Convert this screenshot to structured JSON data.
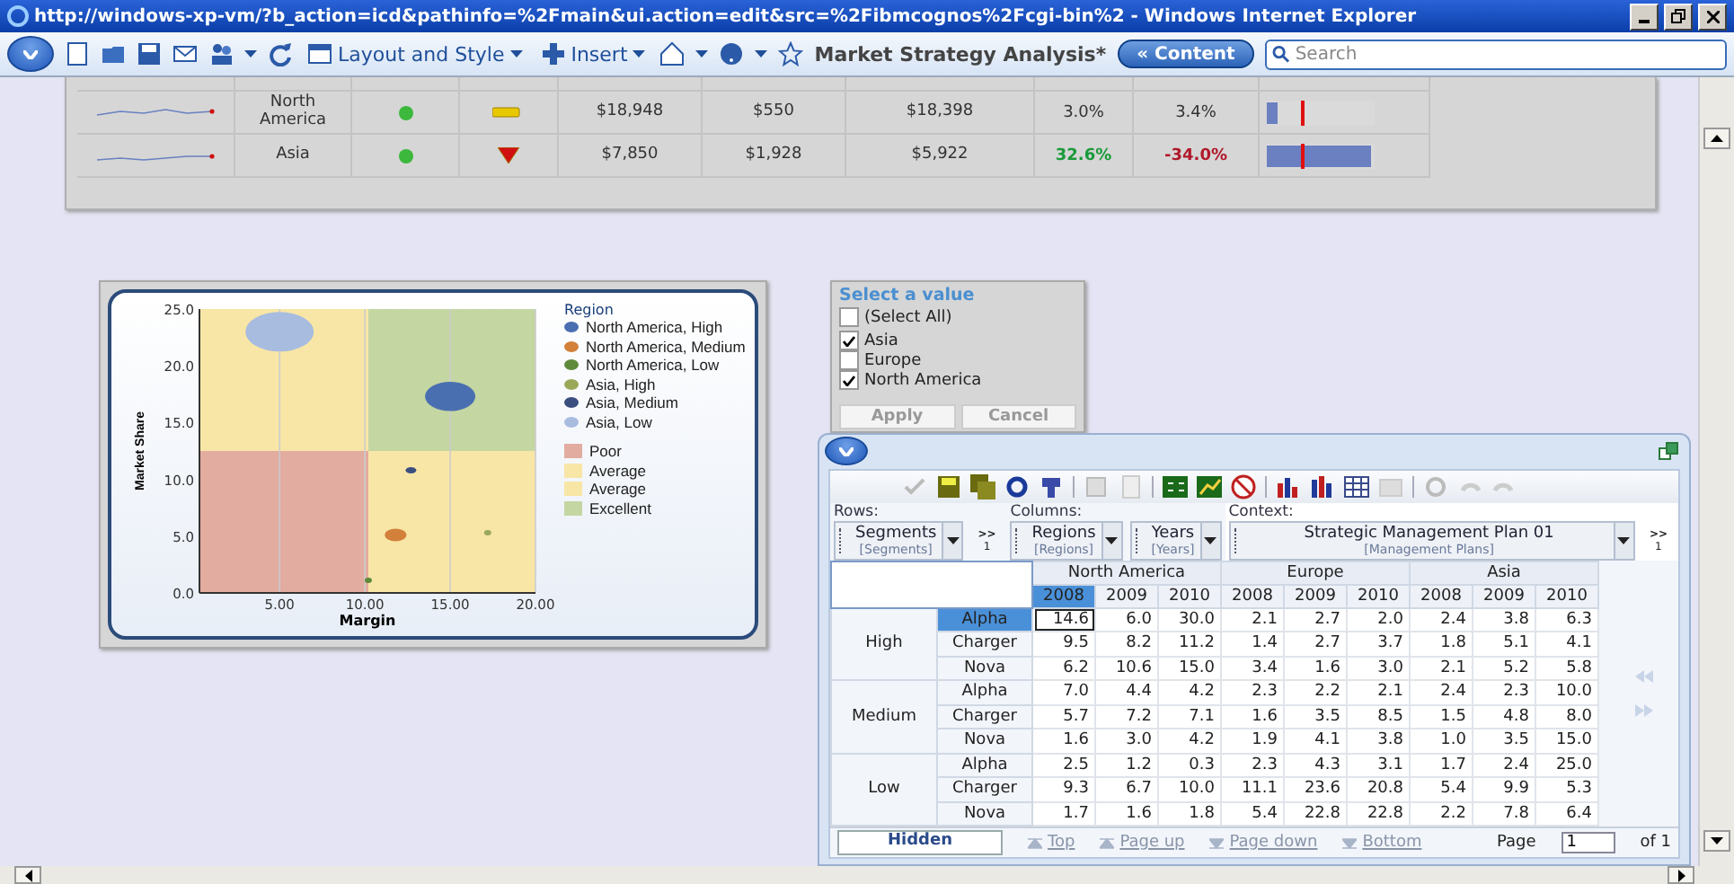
{
  "window": {
    "title": "http://windows-xp-vm/?b_action=icd&pathinfo=%2Fmain&ui.action=edit&src=%2Fibmcognos%2Fcgi-bin%2 - Windows Internet Explorer"
  },
  "toolbar": {
    "menus": [
      {
        "label": "Layout and Style"
      },
      {
        "label": "Insert"
      }
    ],
    "report_title": "Market Strategy Analysis*",
    "content_button": "« Content",
    "search": {
      "placeholder": "Search"
    }
  },
  "summary_table": {
    "rows": [
      {
        "region": "North America",
        "status_dot": {
          "color": "#3cb83c"
        },
        "indicator": {
          "kind": "flat"
        },
        "value_1": "$18,948",
        "value_2": "$550",
        "value_3": "$18,398",
        "change_1": {
          "text": "3.0%",
          "kind": "neutral"
        },
        "change_2": {
          "text": "3.4%",
          "kind": "neutral"
        },
        "bar": {
          "level": 0.1
        }
      },
      {
        "region": "Asia",
        "status_dot": {
          "color": "#3cb83c"
        },
        "indicator": {
          "kind": "down"
        },
        "value_1": "$7,850",
        "value_2": "$1,928",
        "value_3": "$5,922",
        "change_1": {
          "text": "32.6%",
          "kind": "positive"
        },
        "change_2": {
          "text": "-34.0%",
          "kind": "negative"
        },
        "bar": {
          "level": 0.96
        }
      }
    ]
  },
  "bubble_chart": {
    "legend_title": "Region",
    "chart_data": {
      "type": "scatter",
      "xlabel": "Margin",
      "ylabel": "Market Share",
      "xlim": [
        0.3,
        20
      ],
      "ylim": [
        0,
        25
      ],
      "grid": true,
      "xticks": [
        {
          "value": 5,
          "label": "5.00"
        },
        {
          "value": 10,
          "label": "10.00"
        },
        {
          "value": 15,
          "label": "15.00"
        },
        {
          "value": 20,
          "label": "20.00"
        }
      ],
      "yticks": [
        {
          "value": 0,
          "label": "0.0"
        },
        {
          "value": 5,
          "label": "5.0"
        },
        {
          "value": 10,
          "label": "10.0"
        },
        {
          "value": 15,
          "label": "15.0"
        },
        {
          "value": 20,
          "label": "20.0"
        },
        {
          "value": 25,
          "label": "25.0"
        }
      ],
      "series": [
        {
          "name": "North America, High",
          "color": "#4a6fb0",
          "x": [
            15.0
          ],
          "values": [
            17.3
          ]
        },
        {
          "name": "North America, Medium",
          "color": "#d2803a",
          "x": [
            11.8
          ],
          "values": [
            5.1
          ]
        },
        {
          "name": "North America, Low",
          "color": "#5f8a3c",
          "x": [
            10.2
          ],
          "values": [
            1.1
          ]
        },
        {
          "name": "Asia, High",
          "color": "#9aa85a",
          "x": [
            17.2
          ],
          "values": [
            5.3
          ]
        },
        {
          "name": "Asia, Medium",
          "color": "#3a4f80",
          "x": [
            12.7
          ],
          "values": [
            10.8
          ]
        },
        {
          "name": "Asia, Low",
          "color": "#a8bce0",
          "x": [
            5.0
          ],
          "values": [
            23.0
          ]
        }
      ]
    },
    "quality_legend": [
      {
        "label": "Poor",
        "color": "#e2aca0"
      },
      {
        "label": "Average",
        "color": "#f8e6a6"
      },
      {
        "label": "Average",
        "color": "#f8e6a6"
      },
      {
        "label": "Excellent",
        "color": "#c4d6a2"
      }
    ]
  },
  "value_prompt": {
    "title": "Select a value",
    "options": [
      {
        "label": "(Select All)",
        "checked": false
      },
      {
        "label": "Asia",
        "checked": true
      },
      {
        "label": "Europe",
        "checked": false
      },
      {
        "label": "North America",
        "checked": true
      }
    ],
    "buttons": [
      {
        "label": "Apply",
        "disabled": true
      },
      {
        "label": "Cancel",
        "disabled": true
      }
    ]
  },
  "crosstab": {
    "rows": {
      "label": "Rows:",
      "dims": [
        {
          "name": "Segments",
          "sub": "[Segments]"
        }
      ],
      "more": {
        "mark": ">>",
        "count": "1"
      }
    },
    "columns": {
      "label": "Columns:",
      "dims": [
        {
          "name": "Regions",
          "sub": "[Regions]"
        },
        {
          "name": "Years",
          "sub": "[Years]"
        }
      ]
    },
    "context": {
      "label": "Context:",
      "dims": [
        {
          "name": "Strategic Management Plan 01",
          "sub": "[Management Plans]"
        }
      ],
      "more": {
        "mark": ">>",
        "count": "1"
      }
    },
    "regions": [
      {
        "name": "North America",
        "years": [
          {
            "label": "2008",
            "selected": true
          },
          {
            "label": "2009",
            "selected": false
          },
          {
            "label": "2010",
            "selected": false
          }
        ]
      },
      {
        "name": "Europe",
        "years": [
          {
            "label": "2008",
            "selected": false
          },
          {
            "label": "2009",
            "selected": false
          },
          {
            "label": "2010",
            "selected": false
          }
        ]
      },
      {
        "name": "Asia",
        "years": [
          {
            "label": "2008",
            "selected": false
          },
          {
            "label": "2009",
            "selected": false
          },
          {
            "label": "2010",
            "selected": false
          }
        ]
      }
    ],
    "groups": [
      {
        "label": "High",
        "items": [
          {
            "label": "Alpha",
            "selected": true,
            "values": [
              "14.6",
              "6.0",
              "30.0",
              "2.1",
              "2.7",
              "2.0",
              "2.4",
              "3.8",
              "6.3"
            ]
          },
          {
            "label": "Charger",
            "selected": false,
            "values": [
              "9.5",
              "8.2",
              "11.2",
              "1.4",
              "2.7",
              "3.7",
              "1.8",
              "5.1",
              "4.1"
            ]
          },
          {
            "label": "Nova",
            "selected": false,
            "values": [
              "6.2",
              "10.6",
              "15.0",
              "3.4",
              "1.6",
              "3.0",
              "2.1",
              "5.2",
              "5.8"
            ]
          }
        ]
      },
      {
        "label": "Medium",
        "items": [
          {
            "label": "Alpha",
            "selected": false,
            "values": [
              "7.0",
              "4.4",
              "4.2",
              "2.3",
              "2.2",
              "2.1",
              "2.4",
              "2.3",
              "10.0"
            ]
          },
          {
            "label": "Charger",
            "selected": false,
            "values": [
              "5.7",
              "7.2",
              "7.1",
              "1.6",
              "3.5",
              "8.5",
              "1.5",
              "4.8",
              "8.0"
            ]
          },
          {
            "label": "Nova",
            "selected": false,
            "values": [
              "1.6",
              "3.0",
              "4.2",
              "1.9",
              "4.1",
              "3.8",
              "1.0",
              "3.5",
              "15.0"
            ]
          }
        ]
      },
      {
        "label": "Low",
        "items": [
          {
            "label": "Alpha",
            "selected": false,
            "values": [
              "2.5",
              "1.2",
              "0.3",
              "2.3",
              "4.3",
              "3.1",
              "1.7",
              "2.4",
              "25.0"
            ]
          },
          {
            "label": "Charger",
            "selected": false,
            "values": [
              "9.3",
              "6.7",
              "10.0",
              "11.1",
              "23.6",
              "20.8",
              "5.4",
              "9.9",
              "5.3"
            ]
          },
          {
            "label": "Nova",
            "selected": false,
            "values": [
              "1.7",
              "1.6",
              "1.8",
              "5.4",
              "22.8",
              "22.8",
              "2.2",
              "7.8",
              "6.4"
            ]
          }
        ]
      }
    ],
    "footer": {
      "hidden_label": "Hidden",
      "nav": [
        {
          "label": "Top",
          "kind": "up",
          "disabled": true
        },
        {
          "label": "Page up",
          "kind": "up",
          "disabled": true
        },
        {
          "label": "Page down",
          "kind": "down",
          "disabled": true
        },
        {
          "label": "Bottom",
          "kind": "down",
          "disabled": true
        }
      ],
      "page_label": "Page",
      "page_value": "1",
      "page_total": "of 1"
    }
  }
}
